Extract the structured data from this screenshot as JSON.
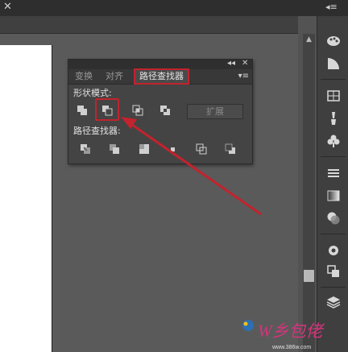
{
  "panel": {
    "tabs": [
      {
        "label": "变换"
      },
      {
        "label": "对齐"
      },
      {
        "label": "路径查找器"
      }
    ],
    "shape_modes_label": "形状模式:",
    "pathfinders_label": "路径查找器:",
    "expand_label": "扩展"
  },
  "watermark": {
    "logo_text": "W乡包佬",
    "url": "www.386w.com"
  },
  "colors": {
    "highlight": "#c2232d",
    "panel_bg": "#444444",
    "canvas_bg": "#5a5a5a"
  },
  "icons": {
    "dock": [
      "palette-icon",
      "color-guide-icon",
      "swatches-icon",
      "brushes-icon",
      "symbols-icon",
      "stroke-icon",
      "gradient-icon",
      "transparency-icon",
      "appearance-icon",
      "graphic-styles-icon",
      "layers-icon"
    ]
  }
}
